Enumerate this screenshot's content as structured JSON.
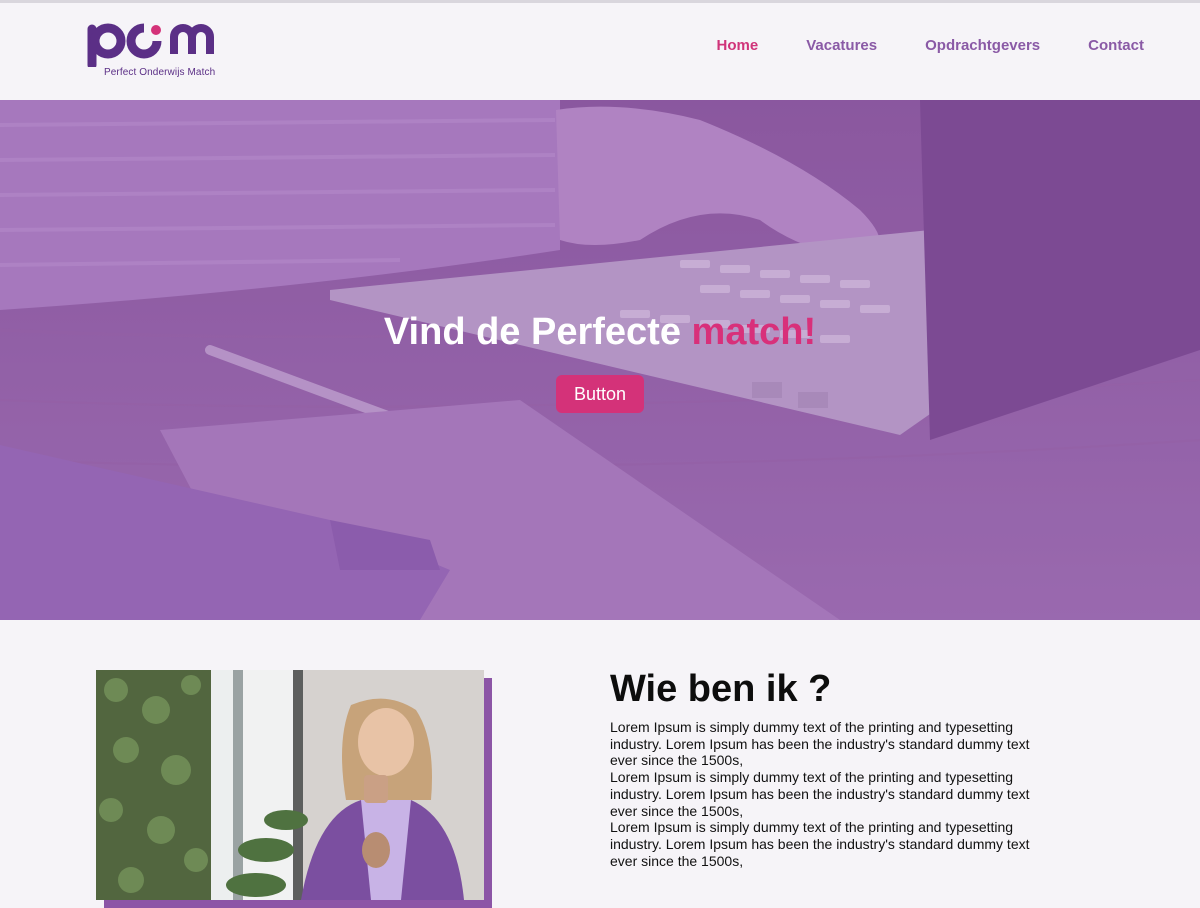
{
  "header": {
    "logo_text": "pom",
    "logo_tagline": "Perfect Onderwijs Match",
    "nav": [
      {
        "label": "Home",
        "active": true
      },
      {
        "label": "Vacatures",
        "active": false
      },
      {
        "label": "Opdrachtgevers",
        "active": false
      },
      {
        "label": "Contact",
        "active": false
      }
    ]
  },
  "hero": {
    "title_main": "Vind de Perfecte ",
    "title_accent": "match!",
    "button_label": "Button"
  },
  "about": {
    "title": "Wie ben ik ?",
    "paragraphs": [
      "Lorem Ipsum is simply dummy text of the printing and typesetting industry. Lorem Ipsum has been the industry's standard dummy text ever since the 1500s,",
      "Lorem Ipsum is simply dummy text of the printing and typesetting industry. Lorem Ipsum has been the industry's standard dummy text ever since the 1500s,",
      "Lorem Ipsum is simply dummy text of the printing and typesetting industry. Lorem Ipsum has been the industry's standard dummy text ever since the 1500s,"
    ]
  },
  "colors": {
    "brand_purple": "#5b2f86",
    "brand_pink": "#d43279",
    "nav_text": "#8a5aa6",
    "hero_tint": "#9a6db4"
  }
}
